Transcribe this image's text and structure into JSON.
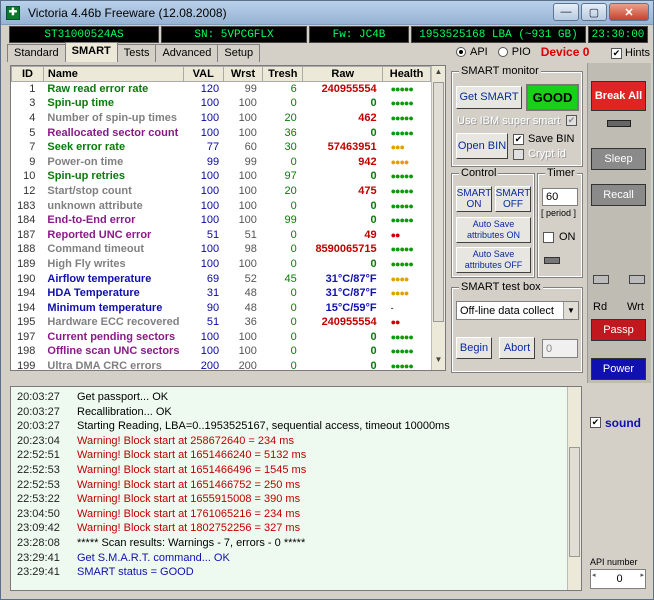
{
  "window": {
    "title": "Victoria 4.46b Freeware (12.08.2008)",
    "minimize": "—",
    "maximize": "▢",
    "close": "✕"
  },
  "info": {
    "model": "ST31000524AS",
    "serial": "SN: 5VPCGFLX",
    "firmware": "Fw: JC4B",
    "lba": "1953525168 LBA (~931 GB)",
    "clock": "23:30:00"
  },
  "tabs": [
    "Standard",
    "SMART",
    "Tests",
    "Advanced",
    "Setup"
  ],
  "mode": {
    "api": "API",
    "pio": "PIO",
    "device": "Device 0",
    "hints": "Hints"
  },
  "smart_table": {
    "headers": [
      "ID",
      "Name",
      "VAL",
      "Wrst",
      "Tresh",
      "Raw",
      "Health"
    ],
    "rows": [
      {
        "id": "1",
        "name": "Raw read error rate",
        "val": "120",
        "wrst": "99",
        "tresh": "6",
        "raw": "240955554",
        "health": "●●●●●",
        "nc": "#0a7a0a",
        "rc": "#c00000",
        "hc": "#0a9a0a"
      },
      {
        "id": "3",
        "name": "Spin-up time",
        "val": "100",
        "wrst": "100",
        "tresh": "0",
        "raw": "0",
        "health": "●●●●●",
        "nc": "#0a7a0a",
        "rc": "#0a7a0a",
        "hc": "#0a9a0a"
      },
      {
        "id": "4",
        "name": "Number of spin-up times",
        "val": "100",
        "wrst": "100",
        "tresh": "20",
        "raw": "462",
        "health": "●●●●●",
        "nc": "#808080",
        "rc": "#c00000",
        "hc": "#0a9a0a"
      },
      {
        "id": "5",
        "name": "Reallocated sector count",
        "val": "100",
        "wrst": "100",
        "tresh": "36",
        "raw": "0",
        "health": "●●●●●",
        "nc": "#8a1a8a",
        "rc": "#0a7a0a",
        "hc": "#0a9a0a"
      },
      {
        "id": "7",
        "name": "Seek error rate",
        "val": "77",
        "wrst": "60",
        "tresh": "30",
        "raw": "57463951",
        "health": "●●●",
        "nc": "#0a7a0a",
        "rc": "#c00000",
        "hc": "#e0a000"
      },
      {
        "id": "9",
        "name": "Power-on time",
        "val": "99",
        "wrst": "99",
        "tresh": "0",
        "raw": "942",
        "health": "●●●●",
        "nc": "#808080",
        "rc": "#c00000",
        "hc": "#e0a000"
      },
      {
        "id": "10",
        "name": "Spin-up retries",
        "val": "100",
        "wrst": "100",
        "tresh": "97",
        "raw": "0",
        "health": "●●●●●",
        "nc": "#0a7a0a",
        "rc": "#0a7a0a",
        "hc": "#0a9a0a"
      },
      {
        "id": "12",
        "name": "Start/stop count",
        "val": "100",
        "wrst": "100",
        "tresh": "20",
        "raw": "475",
        "health": "●●●●●",
        "nc": "#808080",
        "rc": "#c00000",
        "hc": "#0a9a0a"
      },
      {
        "id": "183",
        "name": "unknown attribute",
        "val": "100",
        "wrst": "100",
        "tresh": "0",
        "raw": "0",
        "health": "●●●●●",
        "nc": "#808080",
        "rc": "#0a7a0a",
        "hc": "#0a9a0a"
      },
      {
        "id": "184",
        "name": "End-to-End error",
        "val": "100",
        "wrst": "100",
        "tresh": "99",
        "raw": "0",
        "health": "●●●●●",
        "nc": "#8a1a8a",
        "rc": "#0a7a0a",
        "hc": "#0a9a0a"
      },
      {
        "id": "187",
        "name": "Reported UNC error",
        "val": "51",
        "wrst": "51",
        "tresh": "0",
        "raw": "49",
        "health": "●●",
        "nc": "#8a1a8a",
        "rc": "#c00000",
        "hc": "#d00000"
      },
      {
        "id": "188",
        "name": "Command timeout",
        "val": "100",
        "wrst": "98",
        "tresh": "0",
        "raw": "8590065715",
        "health": "●●●●●",
        "nc": "#808080",
        "rc": "#c00000",
        "hc": "#0a9a0a"
      },
      {
        "id": "189",
        "name": "High Fly writes",
        "val": "100",
        "wrst": "100",
        "tresh": "0",
        "raw": "0",
        "health": "●●●●●",
        "nc": "#808080",
        "rc": "#0a7a0a",
        "hc": "#0a9a0a"
      },
      {
        "id": "190",
        "name": "Airflow temperature",
        "val": "69",
        "wrst": "52",
        "tresh": "45",
        "raw": "31°C/87°F",
        "health": "●●●●",
        "nc": "#1010b0",
        "rc": "#1010b0",
        "hc": "#e0a000"
      },
      {
        "id": "194",
        "name": "HDA Temperature",
        "val": "31",
        "wrst": "48",
        "tresh": "0",
        "raw": "31°C/87°F",
        "health": "●●●●",
        "nc": "#1010b0",
        "rc": "#1010b0",
        "hc": "#e0a000"
      },
      {
        "id": "194",
        "name": "Minimum temperature",
        "val": "90",
        "wrst": "48",
        "tresh": "0",
        "raw": "15°C/59°F",
        "health": "-",
        "nc": "#1010b0",
        "rc": "#1010b0",
        "hc": "#000"
      },
      {
        "id": "195",
        "name": "Hardware ECC recovered",
        "val": "51",
        "wrst": "36",
        "tresh": "0",
        "raw": "240955554",
        "health": "●●",
        "nc": "#808080",
        "rc": "#c00000",
        "hc": "#d00000"
      },
      {
        "id": "197",
        "name": "Current pending sectors",
        "val": "100",
        "wrst": "100",
        "tresh": "0",
        "raw": "0",
        "health": "●●●●●",
        "nc": "#8a1a8a",
        "rc": "#0a7a0a",
        "hc": "#0a9a0a"
      },
      {
        "id": "198",
        "name": "Offline scan UNC sectors",
        "val": "100",
        "wrst": "100",
        "tresh": "0",
        "raw": "0",
        "health": "●●●●●",
        "nc": "#8a1a8a",
        "rc": "#0a7a0a",
        "hc": "#0a9a0a"
      },
      {
        "id": "199",
        "name": "Ultra DMA CRC errors",
        "val": "200",
        "wrst": "200",
        "tresh": "0",
        "raw": "0",
        "health": "●●●●●",
        "nc": "#808080",
        "rc": "#0a7a0a",
        "hc": "#0a9a0a"
      }
    ]
  },
  "smart_monitor": {
    "title": "SMART monitor",
    "get_smart": "Get SMART",
    "status": "GOOD",
    "use_ibm": "Use IBM super smart",
    "open_bin": "Open BIN",
    "save_bin": "Save BIN",
    "crypt": "Crypt id"
  },
  "control": {
    "title": "Control",
    "smart_on": "SMART\nON",
    "smart_off": "SMART\nOFF",
    "autosave_on": "Auto Save\nattributes ON",
    "autosave_off": "Auto Save\nattributes OFF"
  },
  "timer": {
    "title": "Timer",
    "value": "60",
    "period": "[ period ]",
    "on_label": "ON"
  },
  "test_box": {
    "title": "SMART test box",
    "selected": "Off-line data collect",
    "begin": "Begin",
    "abort": "Abort",
    "num": "0"
  },
  "side": {
    "break_all": "Break All",
    "sleep": "Sleep",
    "recall": "Recall",
    "rd": "Rd",
    "wrt": "Wrt",
    "passp": "Passp",
    "power": "Power",
    "sound": "sound",
    "api_number_label": "API number",
    "api_number": "0"
  },
  "log": [
    {
      "t": "20:03:27",
      "m": "Get passport... OK",
      "c": "black"
    },
    {
      "t": "20:03:27",
      "m": "Recallibration... OK",
      "c": "black"
    },
    {
      "t": "20:03:27",
      "m": "Starting Reading, LBA=0..1953525167, sequential access, timeout 10000ms",
      "c": "black"
    },
    {
      "t": "20:23:04",
      "m": "Warning! Block start at 258672640 = 234 ms",
      "c": "red"
    },
    {
      "t": "22:52:51",
      "m": "Warning! Block start at 1651466240 = 5132 ms",
      "c": "red"
    },
    {
      "t": "22:52:53",
      "m": "Warning! Block start at 1651466496 = 1545 ms",
      "c": "red"
    },
    {
      "t": "22:52:53",
      "m": "Warning! Block start at 1651466752 = 250 ms",
      "c": "red"
    },
    {
      "t": "22:53:22",
      "m": "Warning! Block start at 1655915008 = 390 ms",
      "c": "red"
    },
    {
      "t": "23:04:50",
      "m": "Warning! Block start at 1761065216 = 234 ms",
      "c": "red"
    },
    {
      "t": "23:09:42",
      "m": "Warning! Block start at 1802752256 = 327 ms",
      "c": "red"
    },
    {
      "t": "23:28:08",
      "m": "***** Scan results: Warnings - 7, errors - 0 *****",
      "c": "black"
    },
    {
      "t": "23:29:41",
      "m": "Get S.M.A.R.T. command... OK",
      "c": "blue"
    },
    {
      "t": "23:29:41",
      "m": "SMART status = GOOD",
      "c": "blue"
    }
  ]
}
